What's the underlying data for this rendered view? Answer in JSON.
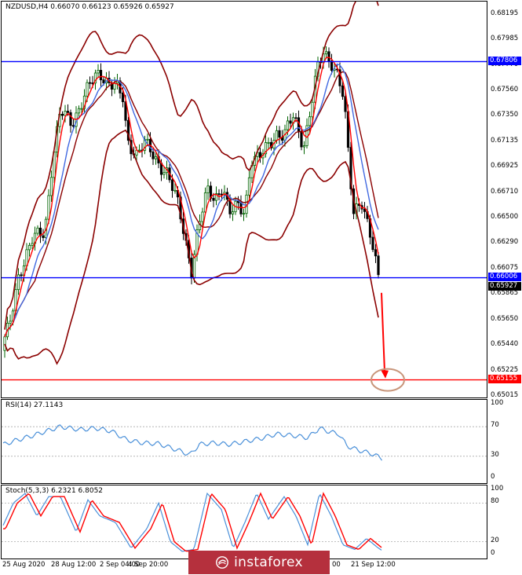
{
  "header": {
    "symbol": "NZDUSD,H4",
    "ohlc": "0.66070 0.66123 0.65926 0.65927"
  },
  "price_axis": {
    "ticks": [
      "0.68195",
      "0.67985",
      "0.67770",
      "0.67560",
      "0.67350",
      "0.67135",
      "0.66925",
      "0.66710",
      "0.66500",
      "0.66290",
      "0.66075",
      "0.65865",
      "0.65650",
      "0.65440",
      "0.65225",
      "0.65015"
    ],
    "tags": [
      {
        "label": "0.67806",
        "value": 0.67806,
        "color": "#0000ff"
      },
      {
        "label": "0.66006",
        "value": 0.66006,
        "color": "#0000ff"
      },
      {
        "label": "0.65927",
        "value": 0.65927,
        "color": "#000000"
      },
      {
        "label": "0.65155",
        "value": 0.65155,
        "color": "#ff0000"
      }
    ]
  },
  "rsi": {
    "title": "RSI(14) 27.1143",
    "ticks": [
      "100",
      "70",
      "30",
      "0"
    ]
  },
  "stoch": {
    "title": "Stoch(5,3,3) 6.2321 6.8052",
    "ticks": [
      "100",
      "80",
      "20",
      "0"
    ]
  },
  "time_axis": {
    "labels": [
      "25 Aug 2020",
      "28 Aug 12:00",
      "2 Sep 04:00",
      "4 Sep 20:00",
      "00",
      "21 Sep 12:00"
    ]
  },
  "watermark": {
    "text": "instaforex"
  },
  "colors": {
    "support_resistance": "#0000ff",
    "target": "#ff0000",
    "bollinger": "#8b0000",
    "fast_ma": "#ff0000",
    "slow_ma": "#4169e1",
    "bull_candle": "#006400",
    "bear_candle": "#000000",
    "rsi_line": "#4a90d9",
    "stoch_main": "#4a90d9",
    "stoch_signal": "#ff0000",
    "target_ellipse": "#c8957a",
    "watermark_bg": "#b5303d"
  }
}
